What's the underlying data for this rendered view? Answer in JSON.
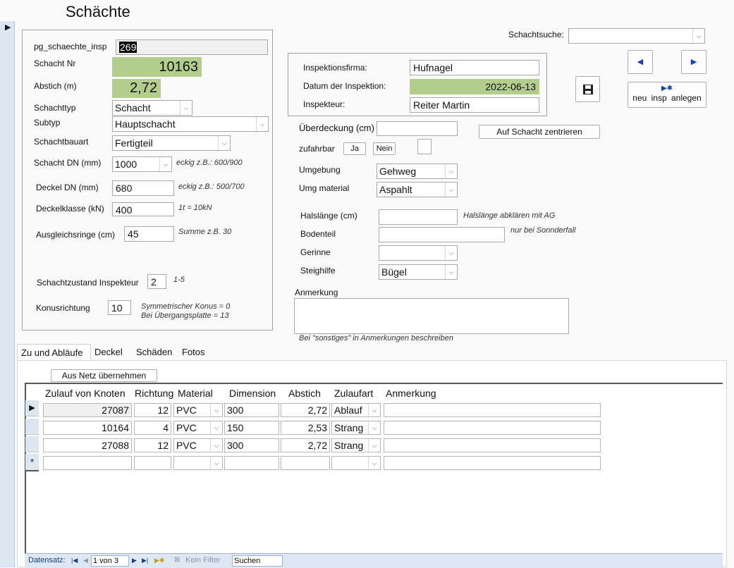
{
  "form": {
    "title": "Schächte"
  },
  "left_panel": {
    "pg_label": "pg_schaechte_insp",
    "pg_value": "269",
    "schacht_nr_label": "Schacht Nr",
    "schacht_nr_value": "10163",
    "abstich_label": "Abstich (m)",
    "abstich_value": "2,72",
    "schachttyp_label": "Schachttyp",
    "schachttyp_value": "Schacht",
    "subtyp_label": "Subtyp",
    "subtyp_value": "Hauptschacht",
    "bauart_label": "Schachtbauart",
    "bauart_value": "Fertigteil",
    "dn_label": "Schacht DN (mm)",
    "dn_value": "1000",
    "dn_hint": "eckig z.B.: 600/900",
    "deckel_dn_label": "Deckel DN (mm)",
    "deckel_dn_value": "680",
    "deckel_dn_hint": "eckig z.B.: 500/700",
    "deckelklasse_label": "Deckelklasse (kN)",
    "deckelklasse_value": "400",
    "deckelklasse_hint": "1t = 10kN",
    "ringe_label": "Ausgleichsringe (cm)",
    "ringe_value": "45",
    "ringe_hint": "Summe z.B. 30",
    "zustand_label": "Schachtzustand Inspekteur",
    "zustand_value": "2",
    "zustand_hint": "1-5",
    "konus_label": "Konusrichtung",
    "konus_value": "10",
    "konus_hint1": "Symmetrischer Konus = 0",
    "konus_hint2": "Bei Übergangsplatte = 13"
  },
  "inspection": {
    "firma_label": "Inspektionsfirma:",
    "firma_value": "Hufnagel",
    "datum_label": "Datum der Inspektion:",
    "datum_value": "2022-06-13",
    "inspekteur_label": "Inspekteur:",
    "inspekteur_value": "Reiter Martin"
  },
  "toolbar": {
    "search_label": "Schachtsuche:",
    "search_value": "",
    "new_insp_label": "neu insp anlegen",
    "center_label": "Auf Schacht zentrieren"
  },
  "middle": {
    "ueberdeckung_label": "Überdeckung (cm)",
    "ueberdeckung_value": "",
    "zufahrbar_label": "zufahrbar",
    "ja_label": "Ja",
    "nein_label": "Nein",
    "umgebung_label": "Umgebung",
    "umgebung_value": "Gehweg",
    "umg_material_label": "Umg material",
    "umg_material_value": "Aspahlt",
    "hals_label": "Halslänge (cm)",
    "hals_value": "",
    "hals_hint": "Halslänge abklären mit AG",
    "bodenteil_label": "Bodenteil",
    "bodenteil_value": "",
    "bodenteil_hint": "nur bei Sonnderfall",
    "gerinne_label": "Gerinne",
    "gerinne_value": "",
    "steighilfe_label": "Steighilfe",
    "steighilfe_value": "Bügel",
    "anmerkung_label": "Anmerkung",
    "anmerkung_value": "",
    "anmerkung_hint": "Bei \"sonstiges\" in Anmerkungen beschreiben"
  },
  "tabs": [
    {
      "label": "Zu und Abläufe"
    },
    {
      "label": "Deckel"
    },
    {
      "label": "Schäden"
    },
    {
      "label": "Fotos"
    }
  ],
  "subform": {
    "aus_netz_label": "Aus Netz übernehmen",
    "columns": [
      "Zulauf von Knoten",
      "Richtung",
      "Material",
      "Dimension",
      "Abstich",
      "Zulaufart",
      "Anmerkung"
    ],
    "rows": [
      {
        "knoten": "27087",
        "richtung": "12",
        "material": "PVC",
        "dimension": "300",
        "abstich": "2,72",
        "zulaufart": "Ablauf",
        "anmerkung": ""
      },
      {
        "knoten": "10164",
        "richtung": "4",
        "material": "PVC",
        "dimension": "150",
        "abstich": "2,53",
        "zulaufart": "Strang",
        "anmerkung": ""
      },
      {
        "knoten": "27088",
        "richtung": "12",
        "material": "PVC",
        "dimension": "300",
        "abstich": "2,72",
        "zulaufart": "Strang",
        "anmerkung": ""
      }
    ],
    "new_row_marker": "*",
    "current_row_marker": "▶"
  },
  "navigation": {
    "datensatz_label": "Datensatz:",
    "record_value": "1 von 3",
    "kein_filter_label": "Kein Filter",
    "suchen_label": "Suchen"
  }
}
